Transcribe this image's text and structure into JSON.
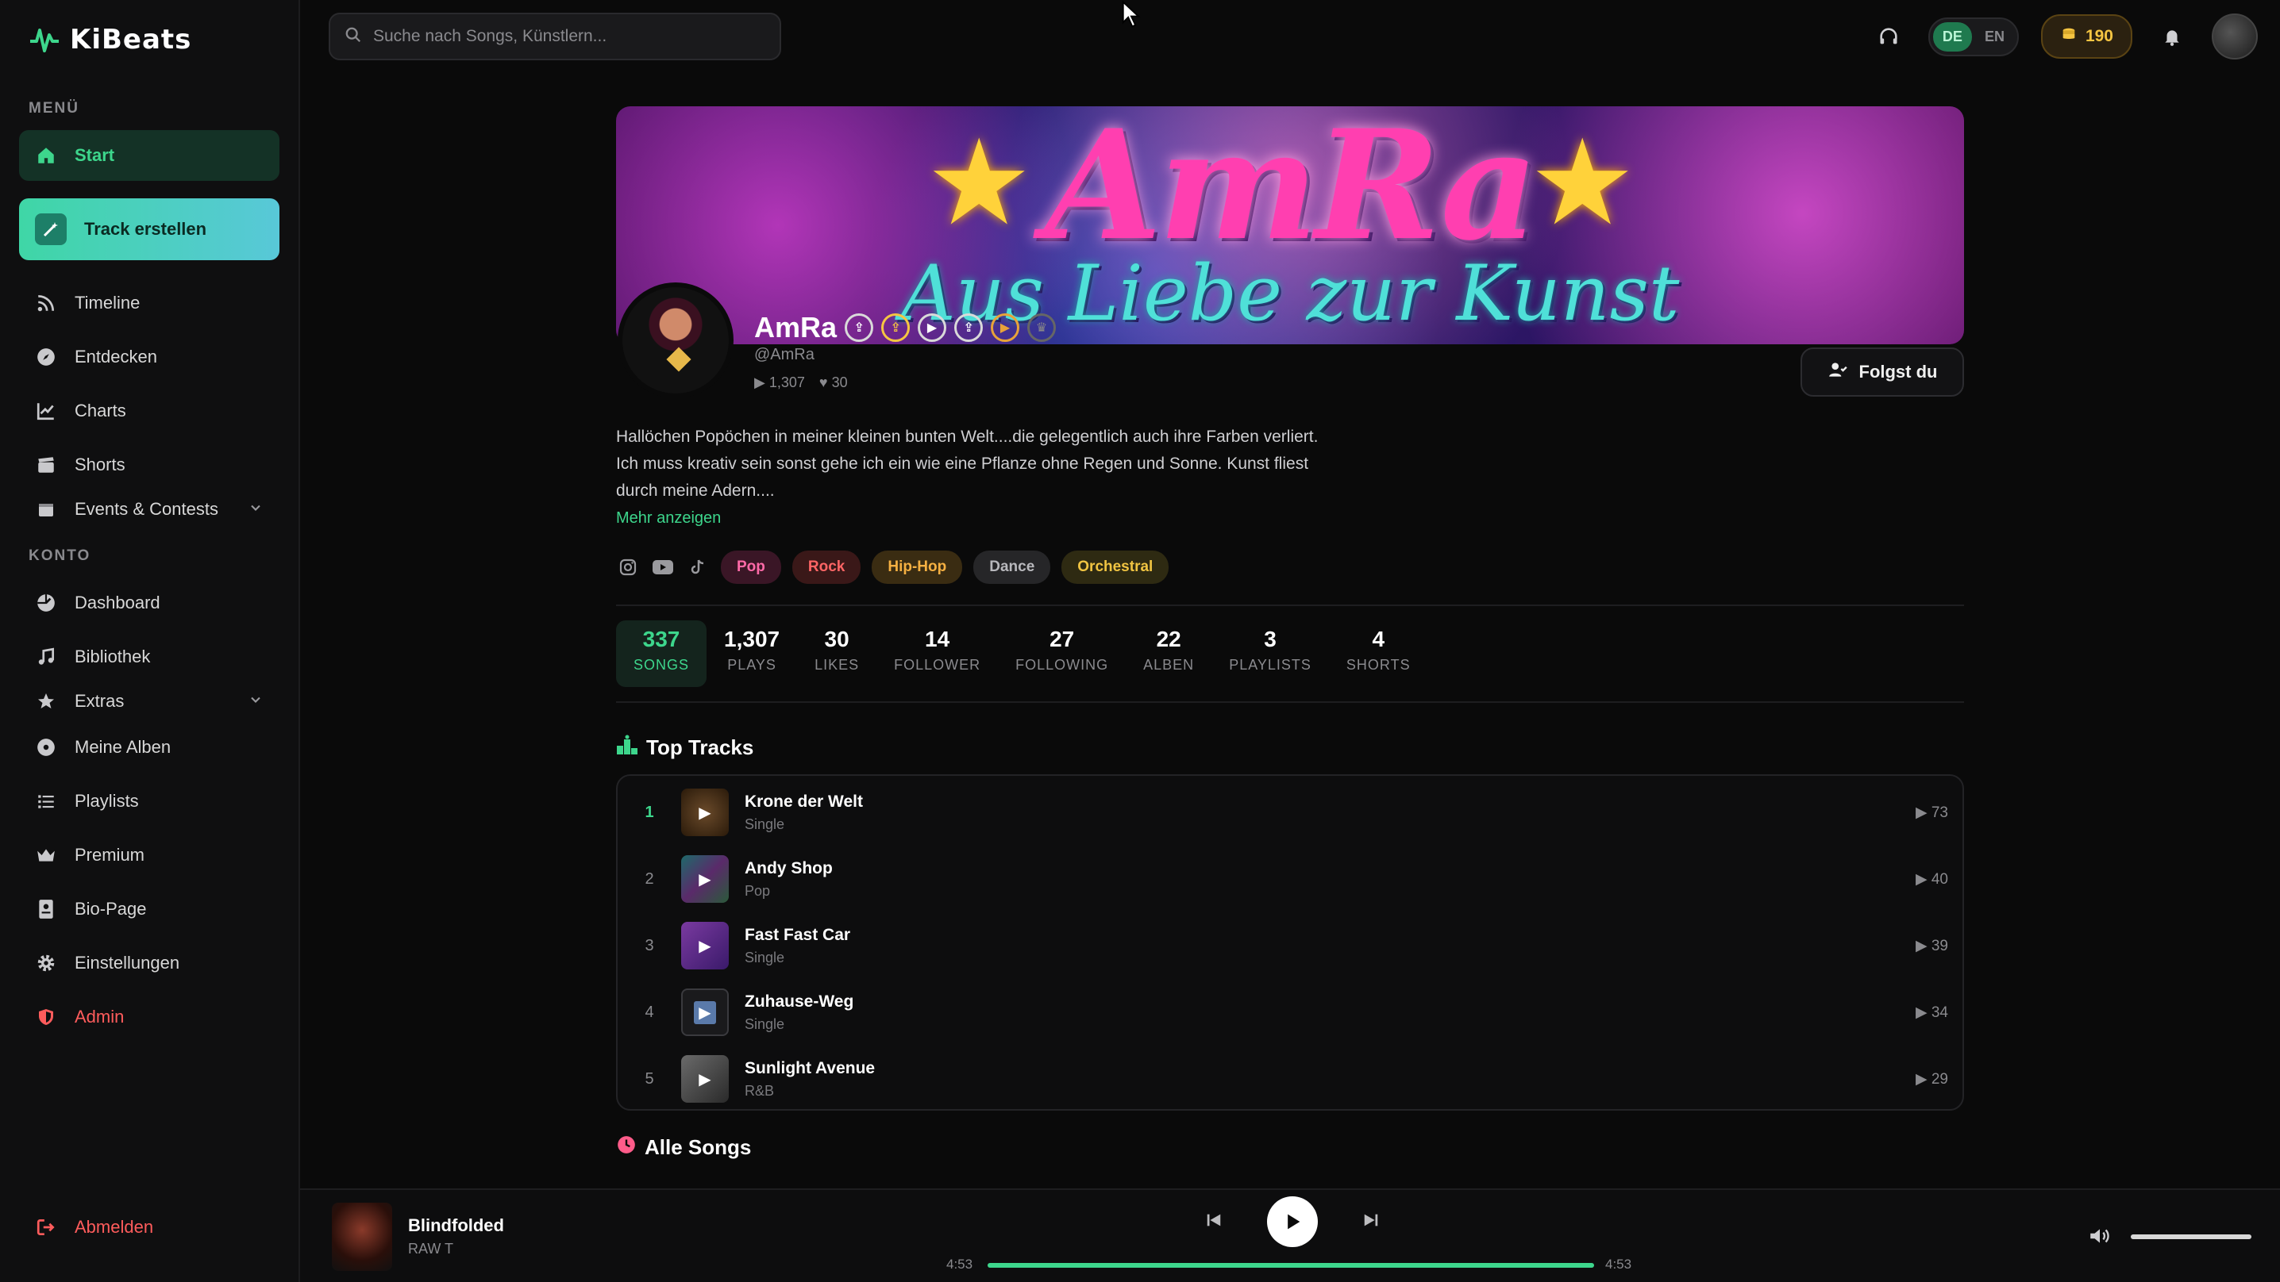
{
  "brand": {
    "name": "KiBeats"
  },
  "sidebar": {
    "menu_label": "MENÜ",
    "account_label": "KONTO",
    "items": [
      {
        "label": "Start",
        "icon": "home-icon"
      },
      {
        "label": "Track erstellen",
        "icon": "magic-wand-icon"
      },
      {
        "label": "Timeline",
        "icon": "rss-icon"
      },
      {
        "label": "Entdecken",
        "icon": "compass-icon"
      },
      {
        "label": "Charts",
        "icon": "chart-line-icon"
      },
      {
        "label": "Shorts",
        "icon": "clapper-icon"
      },
      {
        "label": "Events & Contests",
        "icon": "calendar-icon"
      }
    ],
    "account_items": [
      {
        "label": "Dashboard",
        "icon": "dashboard-icon"
      },
      {
        "label": "Bibliothek",
        "icon": "music-note-icon"
      },
      {
        "label": "Extras",
        "icon": "star-icon"
      },
      {
        "label": "Meine Alben",
        "icon": "disc-icon"
      },
      {
        "label": "Playlists",
        "icon": "list-icon"
      },
      {
        "label": "Premium",
        "icon": "crown-icon"
      },
      {
        "label": "Bio-Page",
        "icon": "id-card-icon"
      },
      {
        "label": "Einstellungen",
        "icon": "gear-icon"
      },
      {
        "label": "Admin",
        "icon": "shield-icon"
      }
    ],
    "logout": "Abmelden"
  },
  "topbar": {
    "search_placeholder": "Suche nach Songs, Künstlern...",
    "lang_de": "DE",
    "lang_en": "EN",
    "coins": "190"
  },
  "banner": {
    "title": "AmRa",
    "subtitle": "Aus Liebe zur Kunst"
  },
  "profile": {
    "name": "AmRa",
    "handle": "@AmRa",
    "plays": "1,307",
    "likes": "30",
    "follow_label": "Folgst du",
    "bio": "Hallöchen Popöchen in meiner kleinen bunten Welt....die gelegentlich auch ihre Farben verliert. Ich muss kreativ sein sonst gehe ich ein wie eine Pflanze ohne Regen und Sonne. Kunst fliest durch meine Adern....",
    "more_label": "Mehr anzeigen",
    "tags": [
      "Pop",
      "Rock",
      "Hip-Hop",
      "Dance",
      "Orchestral"
    ]
  },
  "stats": [
    {
      "num": "337",
      "label": "SONGS"
    },
    {
      "num": "1,307",
      "label": "PLAYS"
    },
    {
      "num": "30",
      "label": "LIKES"
    },
    {
      "num": "14",
      "label": "FOLLOWER"
    },
    {
      "num": "27",
      "label": "FOLLOWING"
    },
    {
      "num": "22",
      "label": "ALBEN"
    },
    {
      "num": "3",
      "label": "PLAYLISTS"
    },
    {
      "num": "4",
      "label": "SHORTS"
    }
  ],
  "top_tracks": {
    "title": "Top Tracks",
    "items": [
      {
        "rank": "1",
        "title": "Krone der Welt",
        "sub": "Single",
        "plays": "73"
      },
      {
        "rank": "2",
        "title": "Andy Shop",
        "sub": "Pop",
        "plays": "40"
      },
      {
        "rank": "3",
        "title": "Fast Fast Car",
        "sub": "Single",
        "plays": "39"
      },
      {
        "rank": "4",
        "title": "Zuhause-Weg",
        "sub": "Single",
        "plays": "34"
      },
      {
        "rank": "5",
        "title": "Sunlight Avenue",
        "sub": "R&B",
        "plays": "29"
      }
    ]
  },
  "all_songs": {
    "title": "Alle Songs"
  },
  "player": {
    "title": "Blindfolded",
    "artist": "RAW T",
    "time_current": "4:53",
    "time_total": "4:53",
    "progress": 1.0,
    "volume": 1.0
  },
  "colors": {
    "accent": "#3dd68c",
    "danger": "#ff5c5c",
    "gold": "#f5c542"
  }
}
